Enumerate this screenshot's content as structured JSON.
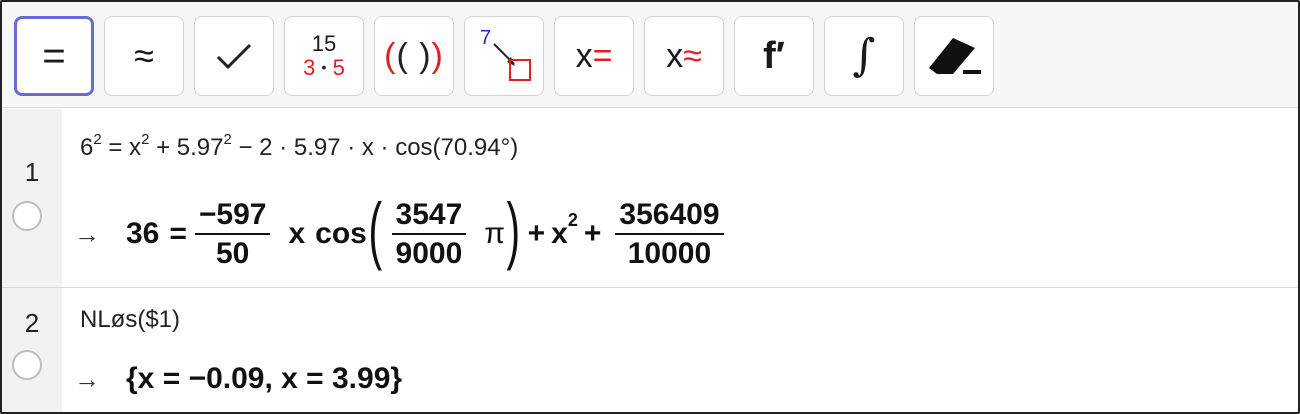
{
  "toolbar": {
    "tools": [
      {
        "id": "evaluate",
        "label": "="
      },
      {
        "id": "numeric",
        "label": "≈"
      },
      {
        "id": "keep-input",
        "label": "✓"
      },
      {
        "id": "factor",
        "top": "15",
        "bottom_left": "3",
        "bottom_dot": "•",
        "bottom_right": "5"
      },
      {
        "id": "expand",
        "label": "(( ))"
      },
      {
        "id": "substitute",
        "label": "7"
      },
      {
        "id": "solve",
        "x": "x",
        "op": "="
      },
      {
        "id": "solve-numerically",
        "x": "x",
        "op": "≈"
      },
      {
        "id": "derivative",
        "label": "f′"
      },
      {
        "id": "integral",
        "label": "∫"
      },
      {
        "id": "delete",
        "label": ""
      }
    ],
    "accent_color": "#6b6bd6",
    "red_color": "#e02020",
    "blue_color": "#1f2bd6"
  },
  "rows": [
    {
      "number": "1",
      "input": {
        "a": "6",
        "a_exp": "2",
        "eq": " = x",
        "x_exp": "2",
        "mid": " + 5.97",
        "mid_exp": "2",
        "rest": " − 2 · 5.97 · x · cos(70.94°)"
      },
      "output": {
        "arrow": "→",
        "lhs": "36",
        "eq": "=",
        "frac1_num": "−597",
        "frac1_den": "50",
        "x": "x",
        "cos": "cos",
        "lparen": "(",
        "frac2_num": "3547",
        "frac2_den": "9000",
        "pi": "π",
        "rparen": ")",
        "plus1": "+",
        "x2": "x",
        "x2_exp": "2",
        "plus2": "+",
        "frac3_num": "356409",
        "frac3_den": "10000"
      }
    },
    {
      "number": "2",
      "input": {
        "text": "NLøs($1)"
      },
      "output": {
        "arrow": "→",
        "text": "{x = −0.09, x = 3.99}"
      }
    }
  ]
}
